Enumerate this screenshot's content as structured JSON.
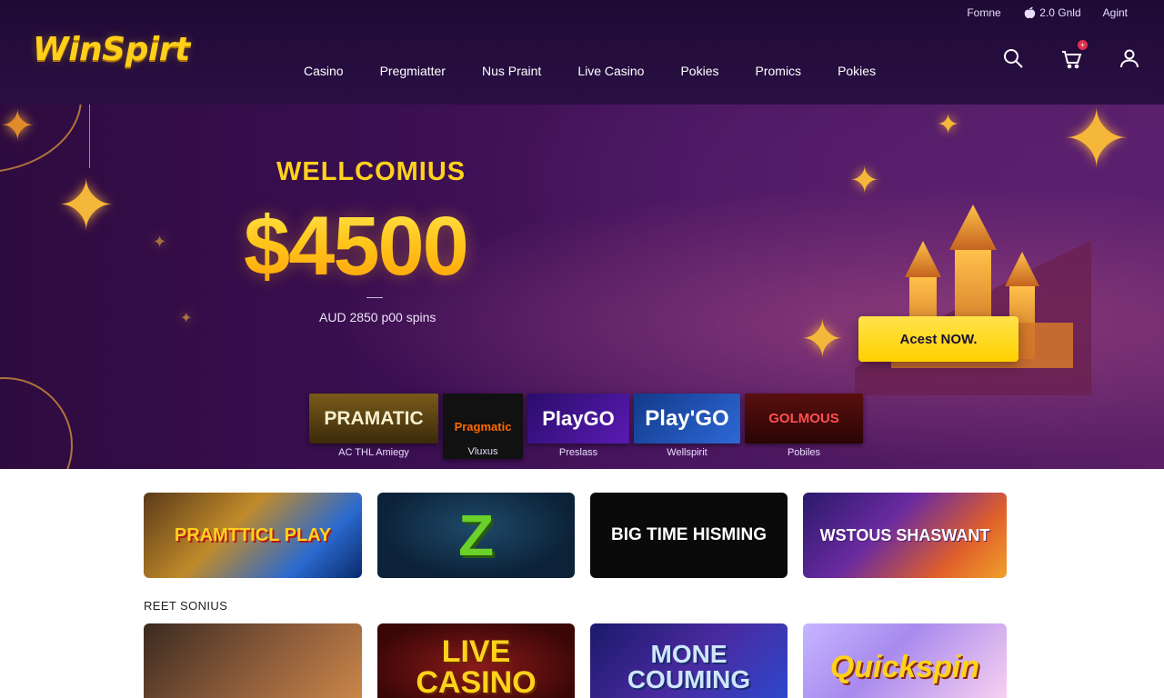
{
  "colors": {
    "brand": "#ffcf1a",
    "header_bg": "#1f0a35",
    "cta": "#ffd000",
    "hero_bg": "#3b0f52"
  },
  "header": {
    "logo": "WinSpirt",
    "utility": [
      "Fomne",
      "2.0 Gnld",
      "Agint"
    ],
    "nav": [
      "Casino",
      "Pregmiatter",
      "Nus Praint",
      "Live Casino",
      "Pokies",
      "Promics",
      "Pokies"
    ],
    "icons": [
      "search-icon",
      "cart-icon",
      "user-icon"
    ]
  },
  "hero": {
    "heading": "WELLCOMIUS",
    "amount": "$4500",
    "subtitle": "AUD 2850 p00 spins",
    "cta": "Acest NOW."
  },
  "providers": [
    {
      "name": "PRAMATIC",
      "caption": "AC THL Amiegy"
    },
    {
      "name": "Pragmatic",
      "caption": "Vluxus"
    },
    {
      "name": "PlayGO",
      "caption": "Preslass"
    },
    {
      "name": "Play'GO",
      "caption": "Wellspirit"
    },
    {
      "name": "GOLMOUS",
      "caption": "Pobiles"
    }
  ],
  "games_row1": [
    {
      "title": "PRAMTTICL PLAY"
    },
    {
      "title": "Z"
    },
    {
      "title": "BIG TIME HISMING"
    },
    {
      "title": "WSTOUS SHASWANT"
    }
  ],
  "section_label": "REET SONIUS",
  "games_row2": [
    {
      "title": ""
    },
    {
      "title": "LIVE CASINO"
    },
    {
      "title": "MONE COUMING"
    },
    {
      "title": "Quickspin"
    }
  ]
}
